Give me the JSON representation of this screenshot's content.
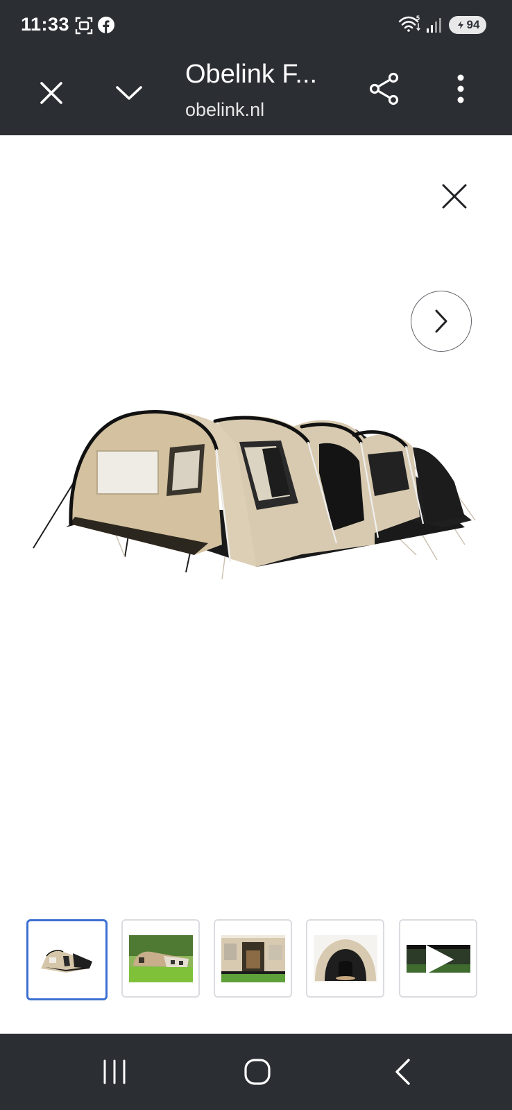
{
  "status_bar": {
    "time": "11:33",
    "battery_level": "94",
    "icons": [
      "screenshot-icon",
      "facebook-icon",
      "wifi-icon",
      "signal-icon",
      "battery-icon"
    ]
  },
  "toolbar": {
    "title": "Obelink F...",
    "domain": "obelink.nl",
    "icons": [
      "close-icon",
      "chevron-down-icon",
      "share-icon",
      "more-vert-icon"
    ]
  },
  "viewer": {
    "icons": [
      "close-icon",
      "chevron-right-icon"
    ],
    "selected_thumbnail": 1,
    "thumbnails": [
      {
        "kind": "image"
      },
      {
        "kind": "image"
      },
      {
        "kind": "image"
      },
      {
        "kind": "image"
      },
      {
        "kind": "video"
      }
    ]
  },
  "nav_bar": {
    "icons": [
      "recent-apps-icon",
      "home-icon",
      "back-icon"
    ]
  },
  "colors": {
    "bar_bg": "#2b2e33",
    "selected_border": "#3c6fd1",
    "thumb_border": "#dadce0",
    "tent_beige": "#d9cbb2",
    "tent_black": "#1f1f1f"
  }
}
